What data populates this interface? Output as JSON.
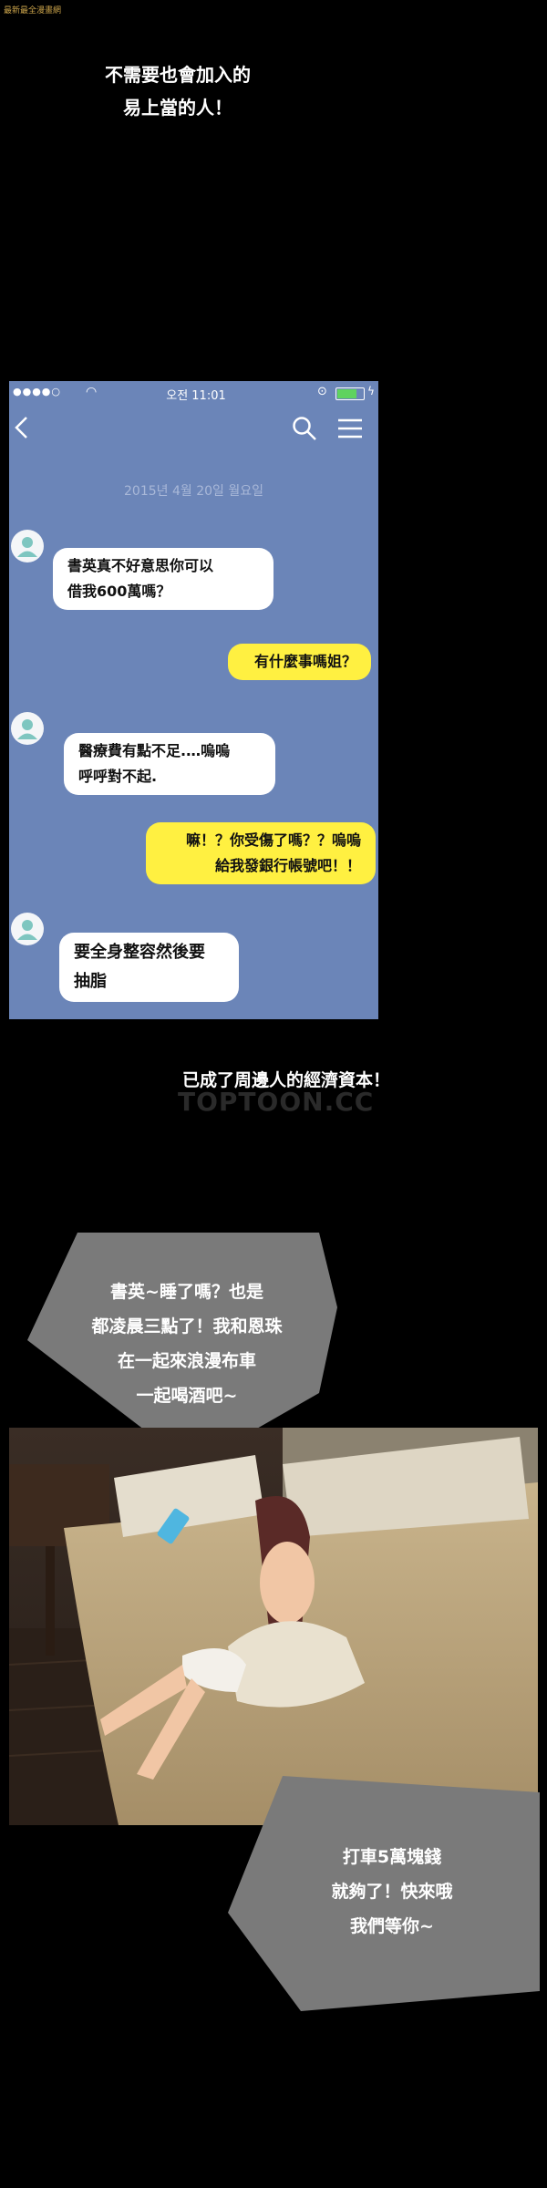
{
  "watermark_top": "最新最全漫畫網",
  "caption_top": [
    "不需要也會加入的",
    "易上當的人！"
  ],
  "phone": {
    "carrier_dots": "●●●●○",
    "time": "오전 11:01",
    "date_separator": "2015년 4월 20일 월요일",
    "messages": [
      {
        "side": "left",
        "lines": [
          "書英真不好意思你可以",
          "借我600萬嗎？"
        ]
      },
      {
        "side": "right",
        "lines": [
          "有什麼事嗎姐？"
        ]
      },
      {
        "side": "left",
        "lines": [
          "醫療費有點不足.…嗚嗚",
          "呼呼對不起."
        ]
      },
      {
        "side": "right",
        "lines": [
          "嘛！？你受傷了嗎？？嗚嗚",
          "給我發銀行帳號吧！！"
        ]
      },
      {
        "side": "left",
        "lines": [
          "要全身整容然後要",
          "抽脂"
        ]
      }
    ]
  },
  "caption_middle": "已成了周邊人的經濟資本！",
  "watermark_middle": "TOPTOON.CC",
  "speech_1": [
    "書英~睡了嗎？也是",
    "都凌晨三點了！我和恩珠",
    "在一起來浪漫布車",
    "一起喝酒吧~"
  ],
  "speech_2": [
    "打車5萬塊錢",
    "就夠了！快來哦",
    "我們等你~"
  ],
  "colors": {
    "background": "#000000",
    "chat_bg": "#6b85b8",
    "bubble_left": "#ffffff",
    "bubble_right": "#fff041",
    "speech_bubble": "#7a7a7a"
  }
}
